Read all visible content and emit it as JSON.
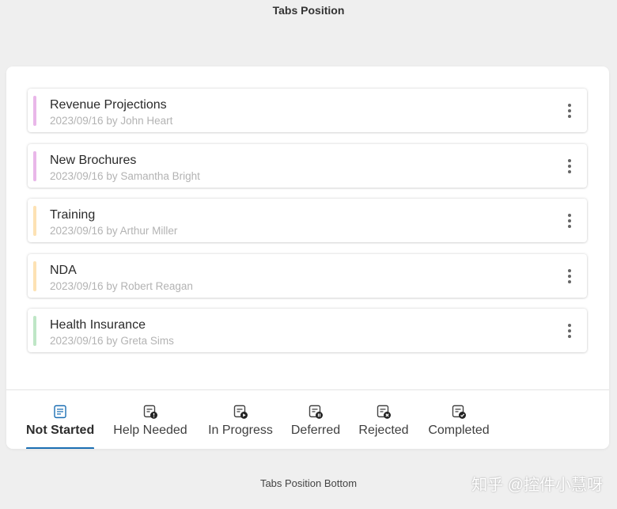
{
  "header": {
    "title": "Tabs Position"
  },
  "tasks": [
    {
      "title": "Revenue Projections",
      "meta": "2023/09/16 by John Heart",
      "marker_color": "#e9b7e9"
    },
    {
      "title": "New Brochures",
      "meta": "2023/09/16 by Samantha Bright",
      "marker_color": "#e9b7e9"
    },
    {
      "title": "Training",
      "meta": "2023/09/16 by Arthur Miller",
      "marker_color": "#fde2b4"
    },
    {
      "title": "NDA",
      "meta": "2023/09/16 by Robert Reagan",
      "marker_color": "#fde2b4"
    },
    {
      "title": "Health Insurance",
      "meta": "2023/09/16 by Greta Sims",
      "marker_color": "#bfe6c6"
    }
  ],
  "tabs": [
    {
      "label": "Not Started",
      "icon": "notes-icon",
      "active": true
    },
    {
      "label": "Help Needed",
      "icon": "clipboard-alert-icon",
      "active": false
    },
    {
      "label": "In Progress",
      "icon": "clipboard-play-icon",
      "active": false
    },
    {
      "label": "Deferred",
      "icon": "clipboard-pause-icon",
      "active": false
    },
    {
      "label": "Rejected",
      "icon": "clipboard-reject-icon",
      "active": false
    },
    {
      "label": "Completed",
      "icon": "clipboard-check-icon",
      "active": false
    }
  ],
  "footer": {
    "caption": "Tabs Position Bottom"
  },
  "watermark": {
    "text": "知乎 @控件小慧呀"
  },
  "colors": {
    "accent": "#1b6fb3",
    "active_icon": "#1b6fb3"
  }
}
